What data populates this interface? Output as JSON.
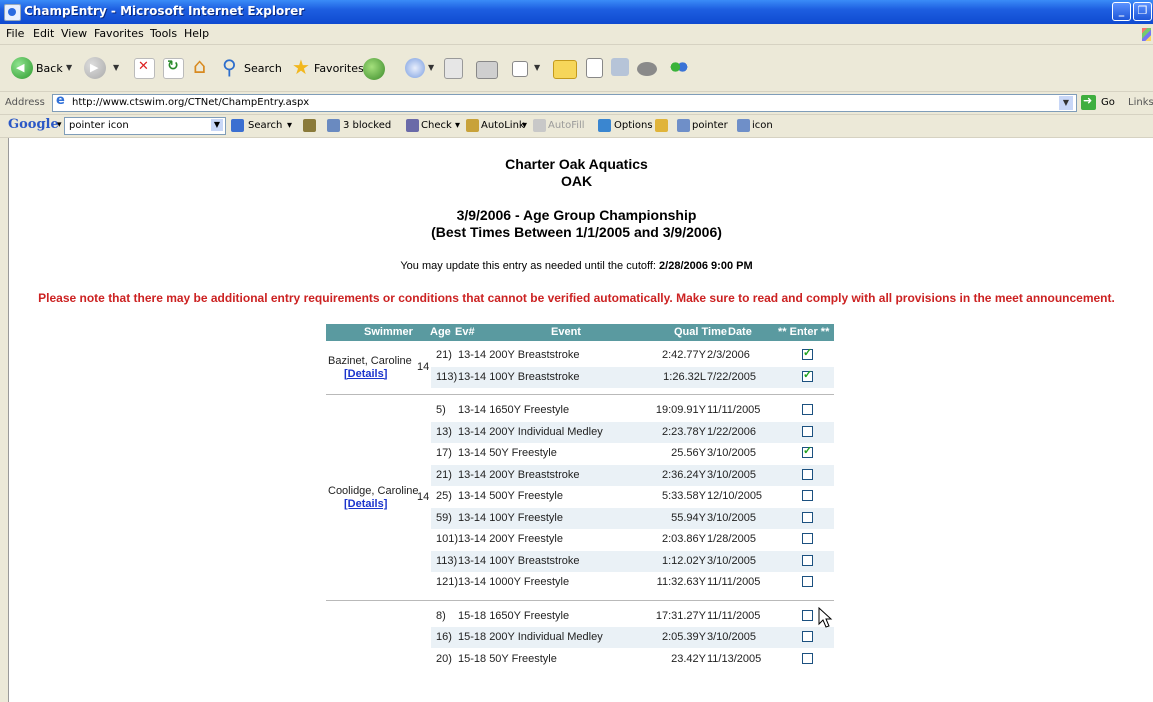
{
  "window": {
    "title": "ChampEntry - Microsoft Internet Explorer",
    "min_glyph": "_",
    "max_glyph": "❐"
  },
  "menu": [
    "File",
    "Edit",
    "View",
    "Favorites",
    "Tools",
    "Help"
  ],
  "toolbar": {
    "back_label": "Back",
    "search_label": "Search",
    "favorites_label": "Favorites"
  },
  "address": {
    "label": "Address",
    "url": "http://www.ctswim.org/CTNet/ChampEntry.aspx",
    "go_label": "Go",
    "links_label": "Links"
  },
  "google_toolbar": {
    "logo": "Google",
    "query": "pointer icon",
    "search_label": "Search",
    "blocked_label": "3 blocked",
    "check_label": "Check",
    "autolink_label": "AutoLink",
    "autofill_label": "AutoFill",
    "options_label": "Options",
    "pointer_label": "pointer",
    "icon_label": "icon"
  },
  "page": {
    "team_name": "Charter Oak Aquatics",
    "team_code": "OAK",
    "meet_name": "3/9/2006 - Age Group Championship",
    "meet_range": "(Best Times Between 1/1/2005 and 3/9/2006)",
    "update_note": "You may update this entry as needed until the cutoff:",
    "cutoff": "2/28/2006 9:00 PM",
    "warning": "Please note that there may be additional entry requirements or conditions that cannot be verified automatically. Make sure to read and comply with all provisions in the meet announcement."
  },
  "table": {
    "headers": {
      "swimmer": "Swimmer",
      "age": "Age",
      "ev": "Ev#",
      "event": "Event",
      "qual_time": "Qual Time",
      "date": "Date",
      "enter": "** Enter **"
    },
    "details_label": "[Details]",
    "swimmers": [
      {
        "name": "Bazinet, Caroline",
        "age": "14",
        "entries": [
          {
            "ev": "21)",
            "event": "13-14 200Y Breaststroke",
            "time": "2:42.77Y",
            "date": "2/3/2006",
            "checked": true
          },
          {
            "ev": "113)",
            "event": "13-14 100Y Breaststroke",
            "time": "1:26.32L",
            "date": "7/22/2005",
            "checked": true
          }
        ]
      },
      {
        "name": "Coolidge, Caroline",
        "age": "14",
        "entries": [
          {
            "ev": "5)",
            "event": "13-14 1650Y Freestyle",
            "time": "19:09.91Y",
            "date": "11/11/2005",
            "checked": false
          },
          {
            "ev": "13)",
            "event": "13-14 200Y Individual Medley",
            "time": "2:23.78Y",
            "date": "1/22/2006",
            "checked": false
          },
          {
            "ev": "17)",
            "event": "13-14 50Y Freestyle",
            "time": "25.56Y",
            "date": "3/10/2005",
            "checked": true
          },
          {
            "ev": "21)",
            "event": "13-14 200Y Breaststroke",
            "time": "2:36.24Y",
            "date": "3/10/2005",
            "checked": false
          },
          {
            "ev": "25)",
            "event": "13-14 500Y Freestyle",
            "time": "5:33.58Y",
            "date": "12/10/2005",
            "checked": false
          },
          {
            "ev": "59)",
            "event": "13-14 100Y Freestyle",
            "time": "55.94Y",
            "date": "3/10/2005",
            "checked": false
          },
          {
            "ev": "101)",
            "event": "13-14 200Y Freestyle",
            "time": "2:03.86Y",
            "date": "1/28/2005",
            "checked": false
          },
          {
            "ev": "113)",
            "event": "13-14 100Y Breaststroke",
            "time": "1:12.02Y",
            "date": "3/10/2005",
            "checked": false
          },
          {
            "ev": "121)",
            "event": "13-14 1000Y Freestyle",
            "time": "11:32.63Y",
            "date": "11/11/2005",
            "checked": false
          }
        ]
      },
      {
        "name": "",
        "age": "",
        "entries": [
          {
            "ev": "8)",
            "event": "15-18 1650Y Freestyle",
            "time": "17:31.27Y",
            "date": "11/11/2005",
            "checked": false
          },
          {
            "ev": "16)",
            "event": "15-18 200Y Individual Medley",
            "time": "2:05.39Y",
            "date": "3/10/2005",
            "checked": false
          },
          {
            "ev": "20)",
            "event": "15-18 50Y Freestyle",
            "time": "23.42Y",
            "date": "11/13/2005",
            "checked": false
          }
        ]
      }
    ]
  }
}
